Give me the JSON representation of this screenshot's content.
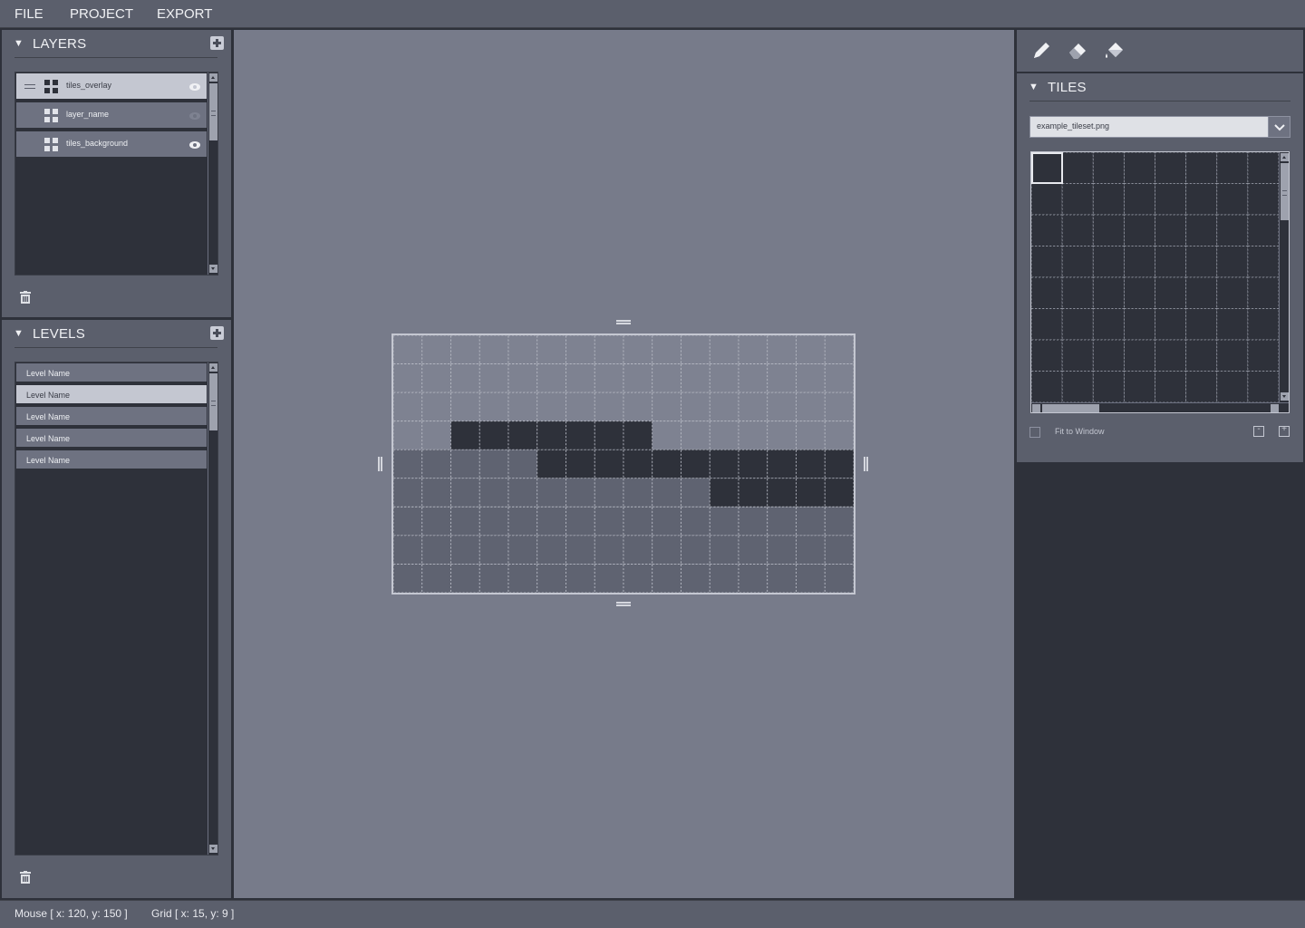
{
  "menu": {
    "file": "FILE",
    "project": "PROJECT",
    "export": "EXPORT"
  },
  "layers_panel": {
    "title": "LAYERS",
    "items": [
      {
        "label": "tiles_overlay",
        "selected": true,
        "visible": true
      },
      {
        "label": "layer_name",
        "selected": false,
        "visible": false
      },
      {
        "label": "tiles_background",
        "selected": false,
        "visible": true
      }
    ]
  },
  "levels_panel": {
    "title": "LEVELS",
    "items": [
      {
        "label": "Level Name",
        "selected": false
      },
      {
        "label": "Level Name",
        "selected": true
      },
      {
        "label": "Level Name",
        "selected": false
      },
      {
        "label": "Level Name",
        "selected": false
      },
      {
        "label": "Level Name",
        "selected": false
      }
    ]
  },
  "tools": [
    "pencil-icon",
    "eraser-icon",
    "fill-bucket-icon"
  ],
  "tiles_panel": {
    "title": "TILES",
    "tileset_file": "example_tileset.png",
    "fit_to_window": "Fit to Window",
    "fit_checked": false
  },
  "map": {
    "columns": 16,
    "rows": 9,
    "cells": [
      "0000000000000000",
      "0000000000000000",
      "0000000000000000",
      "0022222220000000",
      "1111122222222222",
      "1111111111122222",
      "1111111111111111",
      "1111111111111111",
      "1111111111111111"
    ]
  },
  "colors": {
    "empty_cell": "#7e8291",
    "ground_cell": "#5f6371",
    "dark_cell": "#2e313a",
    "selected_row": "#c4c7d1"
  },
  "status": {
    "mouse": "Mouse [ x: 120, y: 150 ]",
    "grid": "Grid [ x: 15, y: 9 ]"
  }
}
